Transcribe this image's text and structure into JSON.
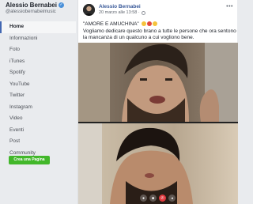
{
  "page": {
    "name": "Alessio Bernabei",
    "handle": "@alessiobernabeimusic"
  },
  "sidebar": {
    "items": [
      {
        "label": "Home",
        "active": true
      },
      {
        "label": "Informazioni"
      },
      {
        "label": "Foto"
      },
      {
        "label": "iTunes"
      },
      {
        "label": "Spotify"
      },
      {
        "label": "YouTube"
      },
      {
        "label": "Twitter"
      },
      {
        "label": "Instagram"
      },
      {
        "label": "Video"
      },
      {
        "label": "Eventi"
      },
      {
        "label": "Post"
      },
      {
        "label": "Community"
      }
    ],
    "create_button": "Crea una Pagina"
  },
  "post": {
    "author": "Alessio Bernabei",
    "date": "20 marzo alle 13:58 ·",
    "text_line1": "\"AMORE E AMUCHINA\"",
    "text_body": "Vogliamo dedicare questo brano a tutte le persone che ora sentono la mancanza di un qualcuno a cui vogliono bene.",
    "more_icon": "more-dots-icon",
    "privacy_icon": "globe-icon"
  },
  "video": {
    "controls": [
      "mic-icon",
      "camera-icon",
      "hangup-icon",
      "speaker-icon"
    ]
  },
  "colors": {
    "accent": "#4267b2",
    "link": "#385898",
    "button_green": "#42b72a",
    "hangup_red": "#e0393e"
  }
}
